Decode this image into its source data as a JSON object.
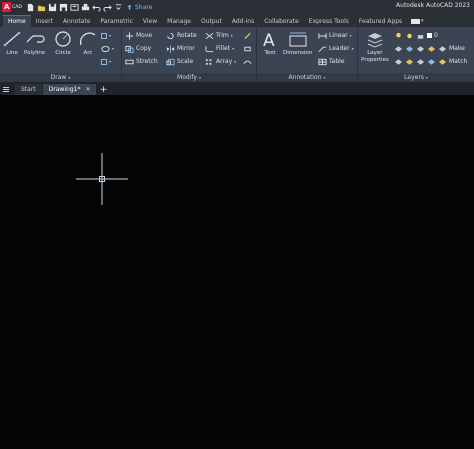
{
  "titlebar": {
    "logo_letter": "A",
    "logo_sub": "CAD",
    "share_label": "Share",
    "app_title": "Autodesk AutoCAD 2023",
    "icons": [
      "new-icon",
      "open-icon",
      "save-icon",
      "save-as-icon",
      "web-save-icon",
      "print-icon",
      "undo-icon",
      "redo-icon",
      "quick-access-menu-icon",
      "share-icon"
    ]
  },
  "ribbon_tabs": [
    "Home",
    "Insert",
    "Annotate",
    "Parametric",
    "View",
    "Manage",
    "Output",
    "Add-ins",
    "Collaborate",
    "Express Tools",
    "Featured Apps"
  ],
  "active_tab": "Home",
  "draw_panel": {
    "label": "Draw",
    "tools": {
      "line": "Line",
      "polyline": "Polyline",
      "circle": "Circle",
      "arc": "Arc"
    }
  },
  "modify_panel": {
    "label": "Modify",
    "tools": {
      "move": "Move",
      "rotate": "Rotate",
      "trim": "Trim",
      "copy": "Copy",
      "mirror": "Mirror",
      "fillet": "Fillet",
      "stretch": "Stretch",
      "scale": "Scale",
      "array": "Array"
    }
  },
  "annotation_panel": {
    "label": "Annotation",
    "tools": {
      "text": "Text",
      "dimension": "Dimension",
      "linear": "Linear",
      "leader": "Leader",
      "table": "Table"
    }
  },
  "layers_panel": {
    "label": "Layers",
    "layer_properties_line1": "Layer",
    "layer_properties_line2": "Properties",
    "current_layer": "0",
    "make_current": "Make",
    "match": "Match"
  },
  "doc_tabs": {
    "start": "Start",
    "drawing": "Drawing1*",
    "close": "✕",
    "add": "+"
  },
  "colors": {
    "accent": "#3b4453",
    "bg": "#030406",
    "brand": "#d11f3d"
  }
}
